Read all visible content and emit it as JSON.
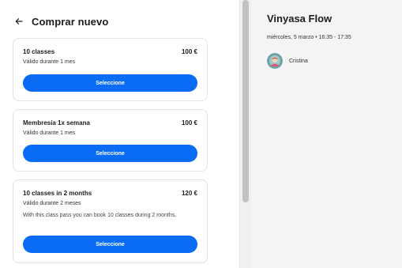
{
  "header": {
    "title": "Comprar nuevo",
    "back_icon": "arrow-left-icon"
  },
  "cards": [
    {
      "name": "10 classes",
      "price": "100 €",
      "validity": "Válido durante 1 mes",
      "description": "",
      "button_label": "Seleccione"
    },
    {
      "name": "Membresía 1x semana",
      "price": "100 €",
      "validity": "Válido durante 1 mes",
      "description": "",
      "button_label": "Seleccione"
    },
    {
      "name": "10 classes in 2 months",
      "price": "120 €",
      "validity": "Válido durante 2 meses",
      "description": "With this class pass you can book 10 classes during 2 months.",
      "button_label": "Seleccione"
    }
  ],
  "class_info": {
    "title": "Vinyasa Flow",
    "datetime": "miércoles, 5 marzo • 16:35 - 17:35",
    "instructor": {
      "name": "Cristina",
      "avatar": "avatar-image"
    }
  },
  "colors": {
    "primary": "#0a6cf5",
    "right_panel_bg": "#f4f4f4",
    "card_border": "#e3e3e3"
  }
}
